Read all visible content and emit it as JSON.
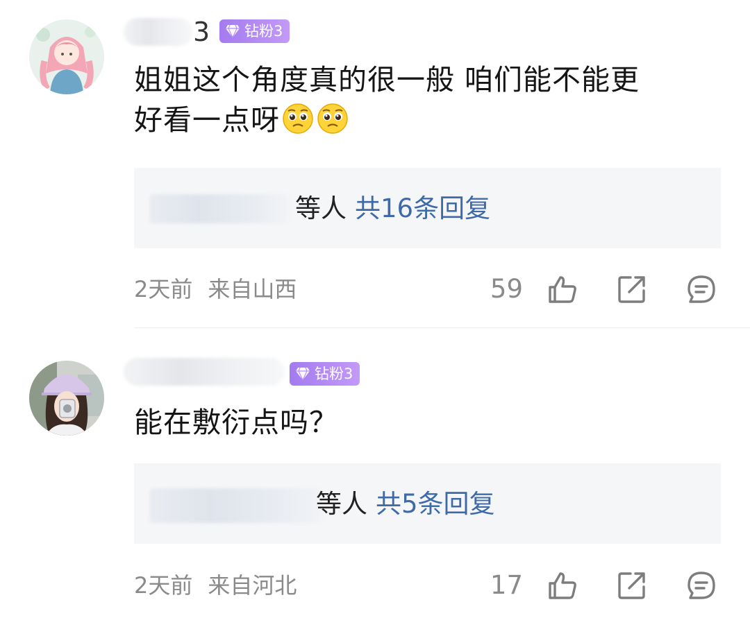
{
  "comments": [
    {
      "username_suffix": "3",
      "badge": "钻粉3",
      "content_line1": "姐姐这个角度真的很一般 咱们能不能更",
      "content_line2": "好看一点呀",
      "emoji": [
        "pleading-face-icon",
        "pleading-face-icon"
      ],
      "reply_who": "等人",
      "reply_count": "共16条回复",
      "time": "2天前",
      "location": "来自山西",
      "likes": "59"
    },
    {
      "badge": "钻粉3",
      "content_line1": "能在敷衍点吗？",
      "reply_who": "等人",
      "reply_count": "共5条回复",
      "time": "2天前",
      "location": "来自河北",
      "likes": "17"
    }
  ],
  "colors": {
    "badge": "#a37bf0",
    "reply_link": "#3e6aa9",
    "meta_text": "#8a8a8a",
    "reply_bg": "#f5f6f7"
  }
}
